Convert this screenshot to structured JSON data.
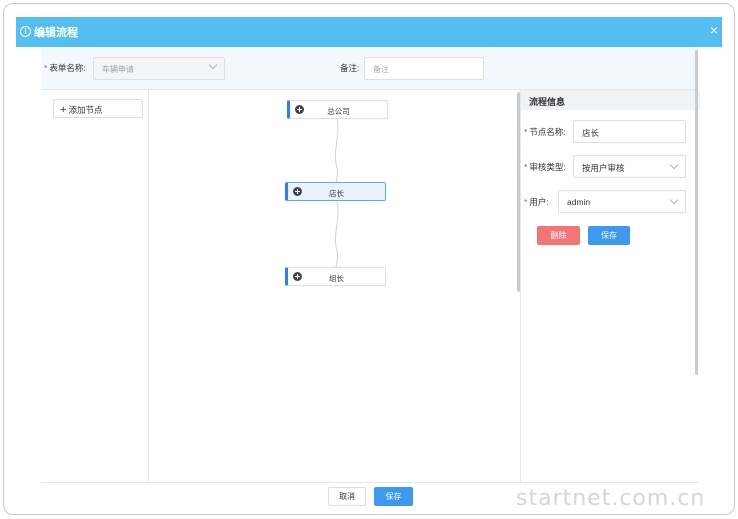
{
  "dialog": {
    "title": "编辑流程",
    "close_glyph": "×"
  },
  "form": {
    "form_name_label": "表单名称:",
    "form_name_value": "车辆申请",
    "remark_label": "备注:",
    "remark_placeholder": "备注"
  },
  "left_panel": {
    "add_node_label": "添加节点"
  },
  "flow": {
    "nodes": [
      {
        "label": "总公司",
        "active": false
      },
      {
        "label": "店长",
        "active": true
      },
      {
        "label": "组长",
        "active": false
      }
    ]
  },
  "right_panel": {
    "header": "流程信息",
    "node_name_label": "节点名称:",
    "node_name_value": "店长",
    "approval_type_label": "审核类型:",
    "approval_type_value": "按用户审核",
    "user_label": "用户:",
    "user_value": "admin",
    "delete_label": "删除",
    "save_label": "保存"
  },
  "footer": {
    "cancel_label": "取消",
    "save_label": "保存"
  },
  "watermark": "startnet.com.cn",
  "colors": {
    "titlebar": "#54bef0",
    "primary": "#3e98f0",
    "danger": "#f37676",
    "required": "#e53e3e",
    "node_accent": "#2d7ef8"
  },
  "icons": {
    "title": "info-circle-icon",
    "close": "close-icon",
    "add": "plus-icon",
    "node": "plus-circle-icon",
    "dropdown": "chevron-down-icon"
  }
}
